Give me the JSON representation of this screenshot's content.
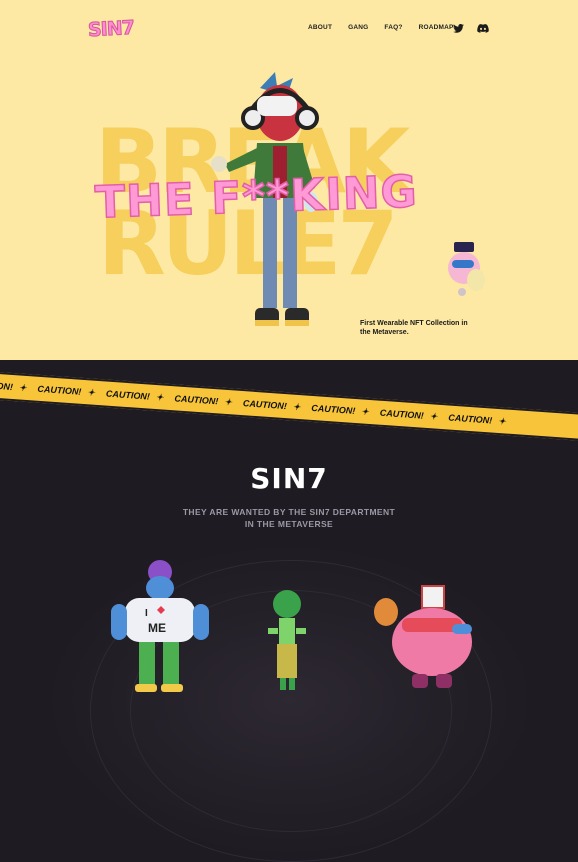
{
  "header": {
    "logo_text": "SIN7",
    "nav": [
      {
        "label": "ABOUT"
      },
      {
        "label": "GANG"
      },
      {
        "label": "FAQ?"
      },
      {
        "label": "ROADMAP"
      }
    ],
    "social_icons": [
      "twitter-icon",
      "discord-icon"
    ]
  },
  "hero": {
    "background_words": [
      "BREAK",
      "RULE7"
    ],
    "tagline": "THE F**KING",
    "caption_line1": "First Wearable NFT Collection in",
    "caption_line2": "the Metaverse."
  },
  "tape": {
    "word": "CAUTION!",
    "separator": "✦",
    "color": "#f8c53a"
  },
  "section": {
    "title": "SIN7",
    "subtitle_line1": "THEY ARE WANTED BY THE SIN7 DEPARTMENT",
    "subtitle_line2": "IN THE METAVERSE"
  },
  "characters": {
    "left_shirt_text1": "I",
    "left_shirt_text2": "ME"
  },
  "colors": {
    "hero_bg": "#fde9a3",
    "dark_bg": "#1e1b22",
    "pink": "#ff8ccf"
  }
}
